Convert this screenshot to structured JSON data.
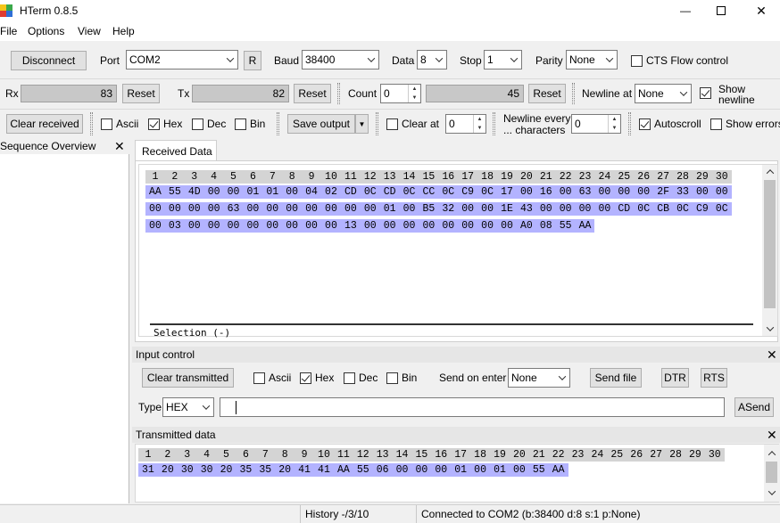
{
  "window": {
    "title": "HTerm 0.8.5",
    "app_icon": "hterm-logo-icon",
    "controls": {
      "minimize": "—",
      "maximize": "☐",
      "close": "✕"
    }
  },
  "menu": [
    "File",
    "Options",
    "View",
    "Help"
  ],
  "connection": {
    "disconnect_label": "Disconnect",
    "port_label": "Port",
    "port_value": "COM2",
    "r_label": "R",
    "baud_label": "Baud",
    "baud_value": "38400",
    "data_label": "Data",
    "data_value": "8",
    "stop_label": "Stop",
    "stop_value": "1",
    "parity_label": "Parity",
    "parity_value": "None",
    "cts_label": "CTS Flow control",
    "cts_checked": false
  },
  "counters": {
    "rx_label": "Rx",
    "rx_value": "83",
    "rx_reset": "Reset",
    "tx_label": "Tx",
    "tx_value": "82",
    "tx_reset": "Reset",
    "count_label": "Count",
    "count_value": "0",
    "count_display": "45",
    "count_reset": "Reset",
    "newline_at_label": "Newline at",
    "newline_at_value": "None",
    "show_newline_line1": "Show",
    "show_newline_line2": "newline",
    "show_newline_checked": true
  },
  "receive_toolbar": {
    "clear_received": "Clear received",
    "ascii": "Ascii",
    "hex": "Hex",
    "dec": "Dec",
    "bin": "Bin",
    "hex_checked": true,
    "save_output": "Save output",
    "clear_at": "Clear at",
    "clear_at_value": "0",
    "newline_every_line1": "Newline every",
    "newline_every_line2": "... characters",
    "newline_every_value": "0",
    "autoscroll": "Autoscroll",
    "autoscroll_checked": true,
    "show_errors": "Show errors"
  },
  "sequence_overview": {
    "title": "Sequence Overview",
    "close": "✕"
  },
  "received": {
    "tab": "Received Data",
    "header": [
      "1",
      "2",
      "3",
      "4",
      "5",
      "6",
      "7",
      "8",
      "9",
      "10",
      "11",
      "12",
      "13",
      "14",
      "15",
      "16",
      "17",
      "18",
      "19",
      "20",
      "21",
      "22",
      "23",
      "24",
      "25",
      "26",
      "27",
      "28",
      "29",
      "30"
    ],
    "rows": [
      [
        "AA",
        "55",
        "4D",
        "00",
        "00",
        "01",
        "01",
        "00",
        "04",
        "02",
        "CD",
        "0C",
        "CD",
        "0C",
        "CC",
        "0C",
        "C9",
        "0C",
        "17",
        "00",
        "16",
        "00",
        "63",
        "00",
        "00",
        "00",
        "2F",
        "33",
        "00",
        "00"
      ],
      [
        "00",
        "00",
        "00",
        "00",
        "63",
        "00",
        "00",
        "00",
        "00",
        "00",
        "00",
        "00",
        "01",
        "00",
        "B5",
        "32",
        "00",
        "00",
        "1E",
        "43",
        "00",
        "00",
        "00",
        "00",
        "CD",
        "0C",
        "CB",
        "0C",
        "C9",
        "0C"
      ],
      [
        "00",
        "03",
        "00",
        "00",
        "00",
        "00",
        "00",
        "00",
        "00",
        "00",
        "13",
        "00",
        "00",
        "00",
        "00",
        "00",
        "00",
        "00",
        "00",
        "A0",
        "08",
        "55",
        "AA"
      ]
    ],
    "selection": "Selection (-)"
  },
  "input_control": {
    "title": "Input control",
    "close": "✕",
    "clear_transmitted": "Clear transmitted",
    "ascii": "Ascii",
    "hex": "Hex",
    "dec": "Dec",
    "bin": "Bin",
    "hex_checked": true,
    "send_on_enter_label": "Send on enter",
    "send_on_enter_value": "None",
    "send_file": "Send file",
    "dtr": "DTR",
    "rts": "RTS",
    "type_label": "Type",
    "type_value": "HEX",
    "input_value": "",
    "asend": "ASend"
  },
  "transmitted": {
    "title": "Transmitted data",
    "close": "✕",
    "header": [
      "1",
      "2",
      "3",
      "4",
      "5",
      "6",
      "7",
      "8",
      "9",
      "10",
      "11",
      "12",
      "13",
      "14",
      "15",
      "16",
      "17",
      "18",
      "19",
      "20",
      "21",
      "22",
      "23",
      "24",
      "25",
      "26",
      "27",
      "28",
      "29",
      "30"
    ],
    "rows": [
      [
        "31",
        "20",
        "30",
        "30",
        "20",
        "35",
        "35",
        "20",
        "41",
        "41",
        "AA",
        "55",
        "06",
        "00",
        "00",
        "00",
        "01",
        "00",
        "01",
        "00",
        "55",
        "AA"
      ]
    ]
  },
  "status": {
    "history": "History -/3/10",
    "connection": "Connected to COM2 (b:38400 d:8 s:1 p:None)"
  }
}
